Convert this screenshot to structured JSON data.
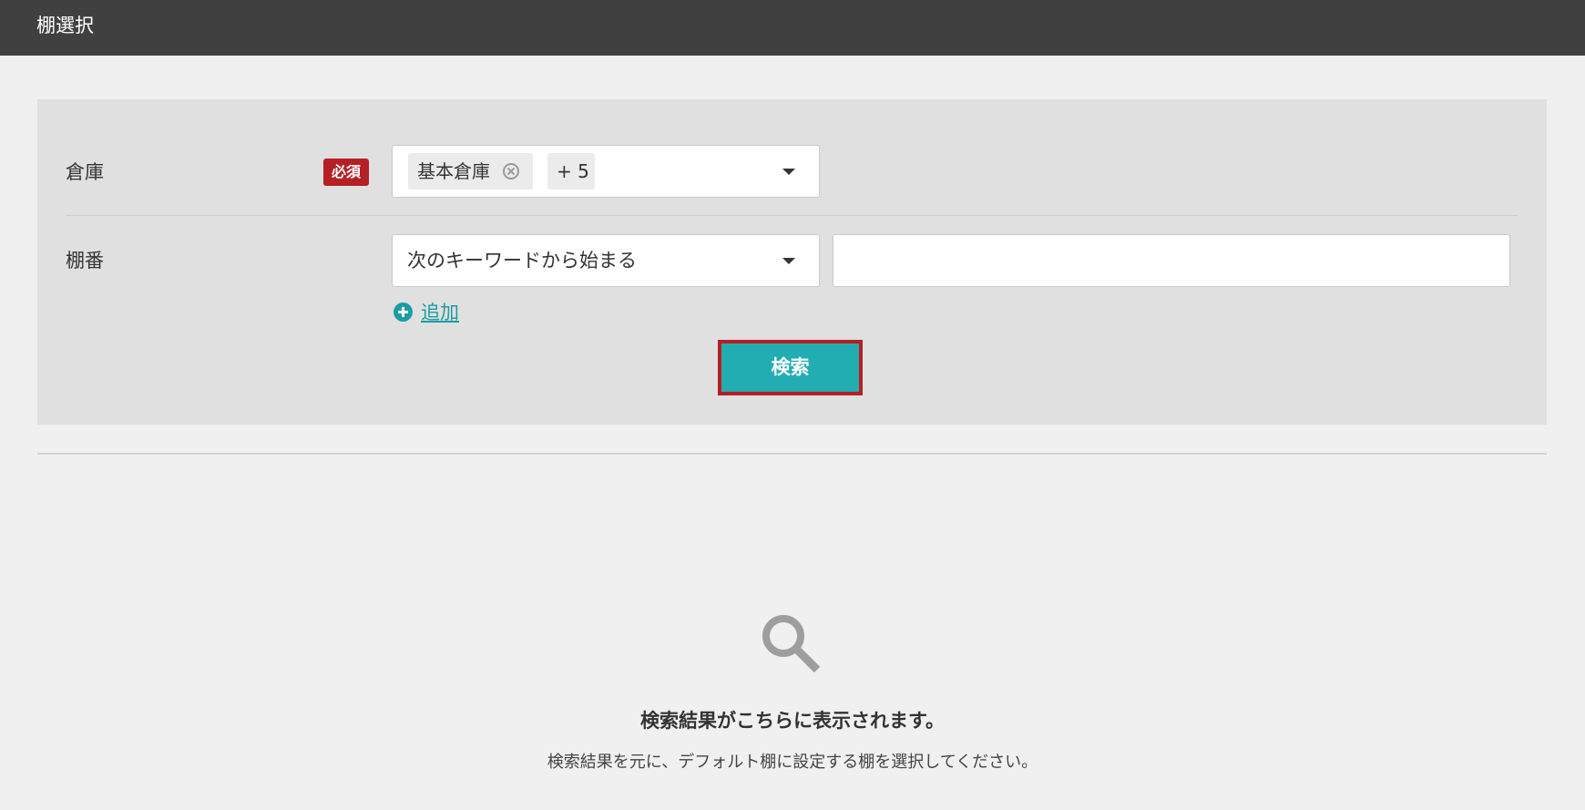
{
  "header": {
    "title": "棚選択"
  },
  "form": {
    "warehouse": {
      "label": "倉庫",
      "required_badge": "必須",
      "selected_tag": "基本倉庫",
      "more_count": "+ 5"
    },
    "shelf": {
      "label": "棚番",
      "match_mode": "次のキーワードから始まる",
      "keyword_value": ""
    },
    "add_label": "追加",
    "search_button": "検索"
  },
  "results": {
    "empty_title": "検索結果がこちらに表示されます。",
    "empty_description": "検索結果を元に、デフォルト棚に設定する棚を選択してください。"
  },
  "icons": {
    "search": "magnifier-icon",
    "add": "plus-circle-icon",
    "dropdown": "caret-down-icon",
    "remove_tag": "circle-x-icon"
  },
  "colors": {
    "header_bg": "#404040",
    "accent": "#22adb3",
    "link": "#1a9ea3",
    "required": "#b42025",
    "highlight_border": "#b42025"
  }
}
